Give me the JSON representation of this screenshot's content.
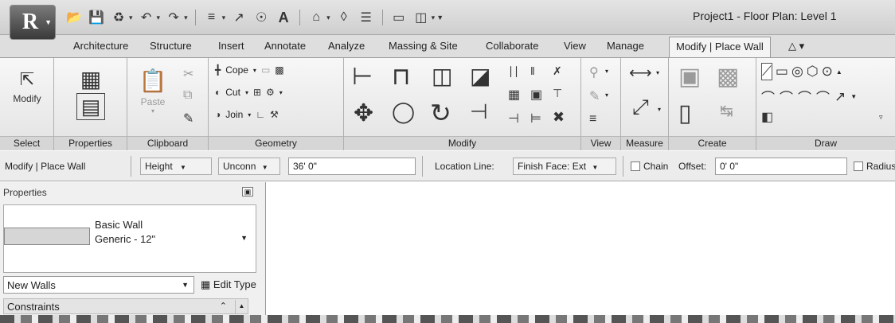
{
  "titlebar": {
    "title": "Project1 - Floor Plan: Level 1"
  },
  "tabs": [
    "Architecture",
    "Structure",
    "Insert",
    "Annotate",
    "Analyze",
    "Massing & Site",
    "Collaborate",
    "View",
    "Manage",
    "Modify | Place Wall"
  ],
  "ribbon": {
    "select": {
      "modify_label": "Modify",
      "panel": "Select"
    },
    "properties": {
      "panel": "Properties"
    },
    "clipboard": {
      "paste_label": "Paste",
      "panel": "Clipboard"
    },
    "geometry": {
      "cope": "Cope",
      "cut": "Cut",
      "join": "Join",
      "panel": "Geometry"
    },
    "modify": {
      "panel": "Modify"
    },
    "view": {
      "panel": "View"
    },
    "measure": {
      "panel": "Measure"
    },
    "create": {
      "panel": "Create"
    },
    "draw": {
      "panel": "Draw"
    }
  },
  "options_bar": {
    "context": "Modify | Place Wall",
    "height_label": "Height",
    "unconn": "Unconn",
    "height_value": "36' 0\"",
    "location_line_label": "Location Line:",
    "location_line_value": "Finish Face: Ext",
    "chain_label": "Chain",
    "offset_label": "Offset:",
    "offset_value": "0' 0\"",
    "radius_label": "Radius"
  },
  "properties": {
    "title": "Properties",
    "type_name_line1": "Basic Wall",
    "type_name_line2": "Generic - 12\"",
    "instance_filter": "New Walls",
    "edit_type": "Edit Type",
    "constraints": "Constraints"
  }
}
